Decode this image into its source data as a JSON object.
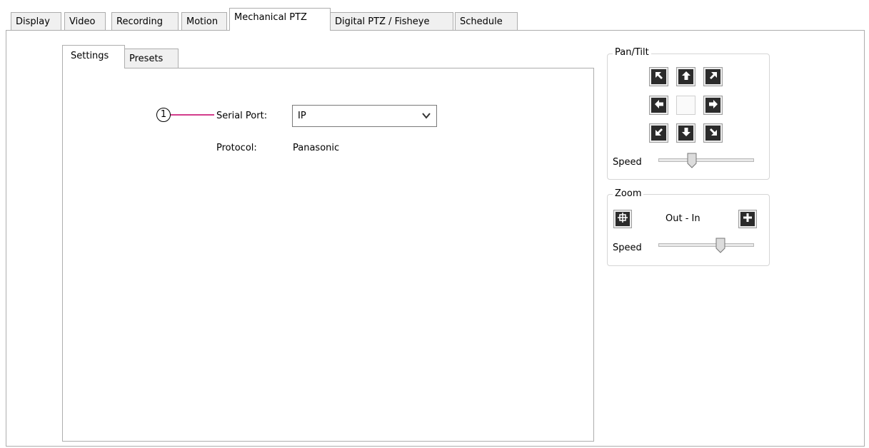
{
  "tabs": [
    {
      "label": "Display",
      "active": false
    },
    {
      "label": "Video",
      "active": false
    },
    {
      "label": "Recording",
      "active": false
    },
    {
      "label": "Motion",
      "active": false
    },
    {
      "label": "Mechanical PTZ",
      "active": true
    },
    {
      "label": "Digital PTZ / Fisheye",
      "active": false
    },
    {
      "label": "Schedule",
      "active": false
    }
  ],
  "subtabs": [
    {
      "label": "Settings",
      "active": true
    },
    {
      "label": "Presets",
      "active": false
    }
  ],
  "settings": {
    "callout_number": "1",
    "serial_port_label": "Serial Port:",
    "serial_port_value": "IP",
    "protocol_label": "Protocol:",
    "protocol_value": "Panasonic"
  },
  "pan_tilt": {
    "title": "Pan/Tilt",
    "speed_label": "Speed",
    "speed_level_fraction": 0.33
  },
  "zoom": {
    "title": "Zoom",
    "range_label": "Out - In",
    "speed_label": "Speed",
    "speed_level_fraction": 0.67
  },
  "colors": {
    "callout_line": "#d33c8b",
    "border": "#adadad",
    "tab_bg": "#f0f0f0",
    "button_dark": "#2b2b2b"
  }
}
